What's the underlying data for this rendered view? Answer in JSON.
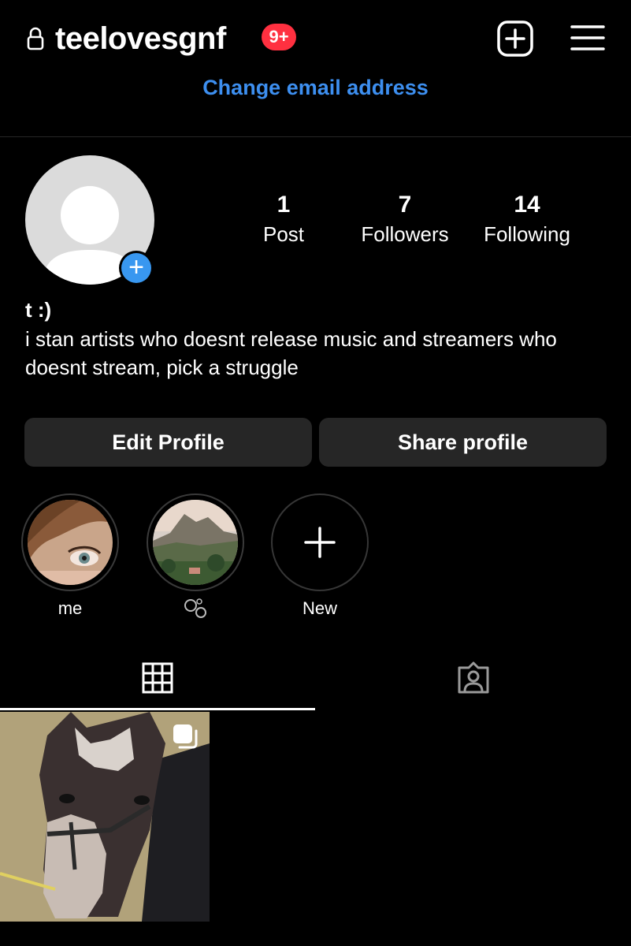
{
  "header": {
    "username": "teelovesgnf",
    "notification_badge": "9+",
    "lock_icon": "lock-icon",
    "new_post_icon": "plus-square-icon",
    "menu_icon": "hamburger-menu-icon",
    "change_email_link": "Change email address",
    "link_color": "#3d8ff0",
    "badge_color": "#ff3040"
  },
  "profile": {
    "avatar_icon": "default-avatar-icon",
    "add_story_icon": "plus-circle-icon",
    "stats": [
      {
        "value": "1",
        "label": "Post"
      },
      {
        "value": "7",
        "label": "Followers"
      },
      {
        "value": "14",
        "label": "Following"
      }
    ],
    "display_name": "t :)",
    "bio": "i stan artists who doesnt release music and streamers who doesnt stream, pick a struggle"
  },
  "actions": {
    "edit_profile": "Edit Profile",
    "share_profile": "Share profile"
  },
  "highlights": [
    {
      "label": "me",
      "icon": "highlight-photo-face"
    },
    {
      "label": "",
      "icon": "bubbles-icon"
    },
    {
      "label": "New",
      "icon": "plus-icon"
    }
  ],
  "tabs": [
    {
      "name": "posts",
      "icon": "grid-icon",
      "active": true
    },
    {
      "name": "tagged",
      "icon": "tagged-person-icon",
      "active": false
    }
  ],
  "posts": [
    {
      "subject": "horse-photo",
      "multi_icon": "carousel-icon"
    }
  ]
}
